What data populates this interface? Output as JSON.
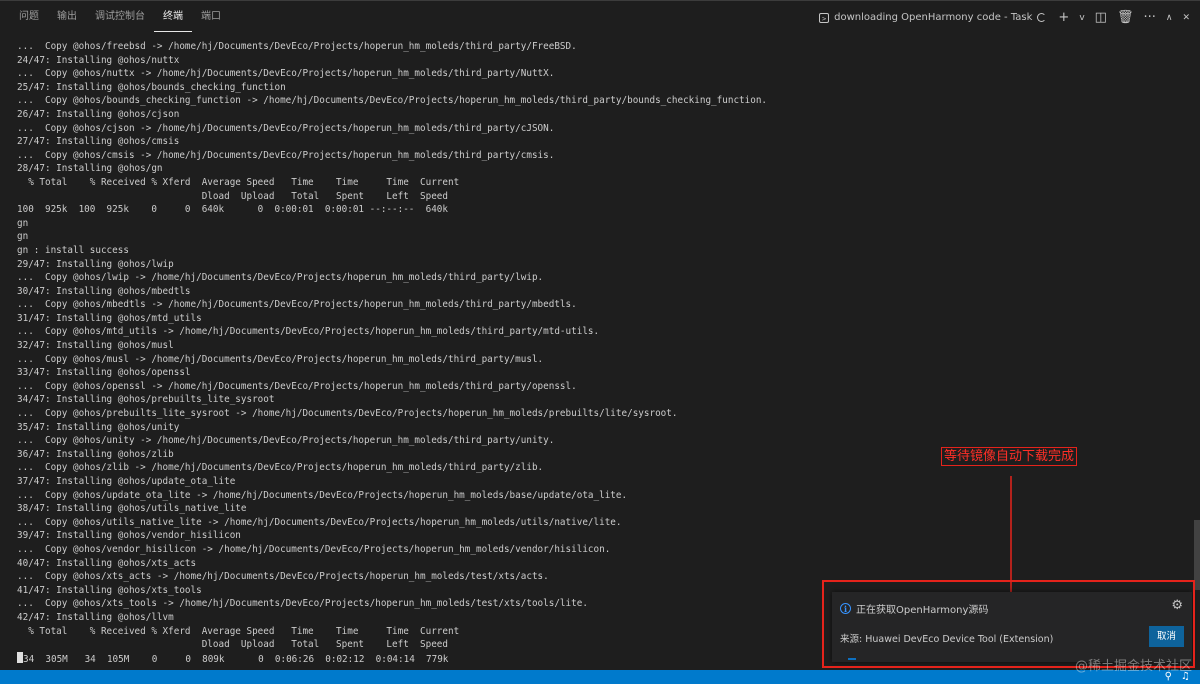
{
  "panel": {
    "tabs": [
      {
        "label": "问题",
        "active": false
      },
      {
        "label": "输出",
        "active": false
      },
      {
        "label": "调试控制台",
        "active": false
      },
      {
        "label": "终端",
        "active": true
      },
      {
        "label": "端口",
        "active": false
      }
    ],
    "task_label": "downloading OpenHarmony code - Task",
    "tools": {
      "add": "+",
      "dropdown": "v",
      "split": "◫",
      "trash": "🗑",
      "more": "···",
      "maximize": "∧",
      "close": "✕"
    }
  },
  "terminal": {
    "lines": [
      "...  Copy @ohos/freebsd -> /home/hj/Documents/DevEco/Projects/hoperun_hm_moleds/third_party/FreeBSD.",
      "24/47: Installing @ohos/nuttx",
      "...  Copy @ohos/nuttx -> /home/hj/Documents/DevEco/Projects/hoperun_hm_moleds/third_party/NuttX.",
      "25/47: Installing @ohos/bounds_checking_function",
      "...  Copy @ohos/bounds_checking_function -> /home/hj/Documents/DevEco/Projects/hoperun_hm_moleds/third_party/bounds_checking_function.",
      "26/47: Installing @ohos/cjson",
      "...  Copy @ohos/cjson -> /home/hj/Documents/DevEco/Projects/hoperun_hm_moleds/third_party/cJSON.",
      "27/47: Installing @ohos/cmsis",
      "...  Copy @ohos/cmsis -> /home/hj/Documents/DevEco/Projects/hoperun_hm_moleds/third_party/cmsis.",
      "28/47: Installing @ohos/gn",
      "  % Total    % Received % Xferd  Average Speed   Time    Time     Time  Current",
      "                                 Dload  Upload   Total   Spent    Left  Speed",
      "100  925k  100  925k    0     0  640k      0  0:00:01  0:00:01 --:--:--  640k",
      "gn",
      "gn",
      "gn : install success",
      "29/47: Installing @ohos/lwip",
      "...  Copy @ohos/lwip -> /home/hj/Documents/DevEco/Projects/hoperun_hm_moleds/third_party/lwip.",
      "30/47: Installing @ohos/mbedtls",
      "...  Copy @ohos/mbedtls -> /home/hj/Documents/DevEco/Projects/hoperun_hm_moleds/third_party/mbedtls.",
      "31/47: Installing @ohos/mtd_utils",
      "...  Copy @ohos/mtd_utils -> /home/hj/Documents/DevEco/Projects/hoperun_hm_moleds/third_party/mtd-utils.",
      "32/47: Installing @ohos/musl",
      "...  Copy @ohos/musl -> /home/hj/Documents/DevEco/Projects/hoperun_hm_moleds/third_party/musl.",
      "33/47: Installing @ohos/openssl",
      "...  Copy @ohos/openssl -> /home/hj/Documents/DevEco/Projects/hoperun_hm_moleds/third_party/openssl.",
      "34/47: Installing @ohos/prebuilts_lite_sysroot",
      "...  Copy @ohos/prebuilts_lite_sysroot -> /home/hj/Documents/DevEco/Projects/hoperun_hm_moleds/prebuilts/lite/sysroot.",
      "35/47: Installing @ohos/unity",
      "...  Copy @ohos/unity -> /home/hj/Documents/DevEco/Projects/hoperun_hm_moleds/third_party/unity.",
      "36/47: Installing @ohos/zlib",
      "...  Copy @ohos/zlib -> /home/hj/Documents/DevEco/Projects/hoperun_hm_moleds/third_party/zlib.",
      "37/47: Installing @ohos/update_ota_lite",
      "...  Copy @ohos/update_ota_lite -> /home/hj/Documents/DevEco/Projects/hoperun_hm_moleds/base/update/ota_lite.",
      "38/47: Installing @ohos/utils_native_lite",
      "...  Copy @ohos/utils_native_lite -> /home/hj/Documents/DevEco/Projects/hoperun_hm_moleds/utils/native/lite.",
      "39/47: Installing @ohos/vendor_hisilicon",
      "...  Copy @ohos/vendor_hisilicon -> /home/hj/Documents/DevEco/Projects/hoperun_hm_moleds/vendor/hisilicon.",
      "40/47: Installing @ohos/xts_acts",
      "...  Copy @ohos/xts_acts -> /home/hj/Documents/DevEco/Projects/hoperun_hm_moleds/test/xts/acts.",
      "41/47: Installing @ohos/xts_tools",
      "...  Copy @ohos/xts_tools -> /home/hj/Documents/DevEco/Projects/hoperun_hm_moleds/test/xts/tools/lite.",
      "42/47: Installing @ohos/llvm",
      "  % Total    % Received % Xferd  Average Speed   Time    Time     Time  Current",
      "                                 Dload  Upload   Total   Spent    Left  Speed"
    ],
    "last_line": "34  305M   34  105M    0     0  809k      0  0:06:26  0:02:12  0:04:14  779k"
  },
  "annotation": {
    "text": "等待镜像自动下载完成",
    "color": "#e5231b"
  },
  "notification": {
    "title": "正在获取OpenHarmony源码",
    "source": "来源: Huawei DevEco Device Tool (Extension)",
    "cancel_label": "取消",
    "icon": "info-icon"
  },
  "watermark": "@稀土掘金技术社区",
  "colors": {
    "background": "#1e1e1e",
    "status_bar": "#007acc",
    "button": "#0e639c",
    "annotation_red": "#e5231b"
  }
}
